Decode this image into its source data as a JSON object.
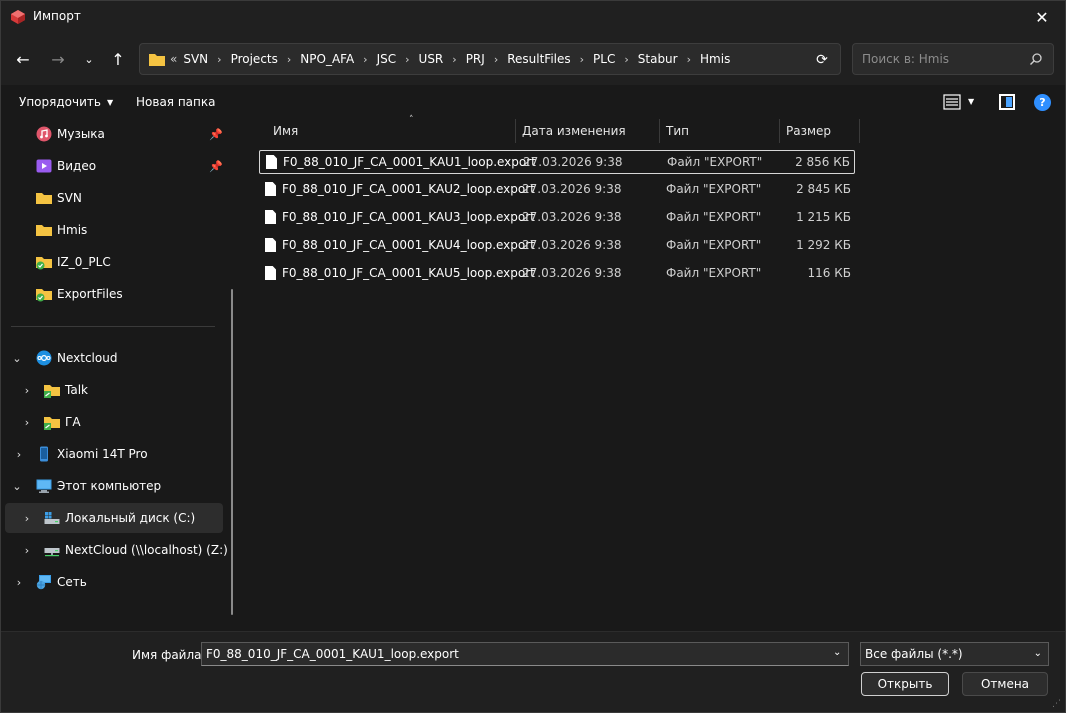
{
  "window": {
    "title": "Импорт"
  },
  "nav": {
    "address_lead": "«",
    "crumbs": [
      "SVN",
      "Projects",
      "NPO_AFA",
      "JSC",
      "USR",
      "PRJ",
      "ResultFiles",
      "PLC",
      "Stabur",
      "Hmis"
    ],
    "search_placeholder": "Поиск в: Hmis"
  },
  "toolbar": {
    "organize_label": "Упорядочить",
    "new_folder_label": "Новая папка"
  },
  "sidebar": {
    "items": [
      {
        "label": "Музыка",
        "icon": "music-icon",
        "pinned": true
      },
      {
        "label": "Видео",
        "icon": "video-icon",
        "pinned": true
      },
      {
        "label": "SVN",
        "icon": "folder-icon"
      },
      {
        "label": "Hmis",
        "icon": "folder-icon"
      },
      {
        "label": "IZ_0_PLC",
        "icon": "svn-folder-icon"
      },
      {
        "label": "ExportFiles",
        "icon": "svn-folder-icon"
      },
      {
        "label": "Nextcloud",
        "icon": "nextcloud-icon"
      },
      {
        "label": "Talk",
        "icon": "shared-folder-icon"
      },
      {
        "label": "ГА",
        "icon": "shared-folder-icon"
      },
      {
        "label": "Xiaomi 14T Pro",
        "icon": "phone-icon"
      },
      {
        "label": "Этот компьютер",
        "icon": "computer-icon"
      },
      {
        "label": "Локальный диск (C:)",
        "icon": "drive-icon"
      },
      {
        "label": "NextCloud (\\\\localhost) (Z:)",
        "icon": "network-drive-icon"
      },
      {
        "label": "Сеть",
        "icon": "network-icon"
      }
    ]
  },
  "columns": {
    "name": "Имя",
    "date": "Дата изменения",
    "type": "Тип",
    "size": "Размер"
  },
  "files": [
    {
      "name": "F0_88_010_JF_CA_0001_KAU1_loop.export",
      "date": "27.03.2026 9:38",
      "type": "Файл \"EXPORT\"",
      "size": "2 856 КБ"
    },
    {
      "name": "F0_88_010_JF_CA_0001_KAU2_loop.export",
      "date": "27.03.2026 9:38",
      "type": "Файл \"EXPORT\"",
      "size": "2 845 КБ"
    },
    {
      "name": "F0_88_010_JF_CA_0001_KAU3_loop.export",
      "date": "27.03.2026 9:38",
      "type": "Файл \"EXPORT\"",
      "size": "1 215 КБ"
    },
    {
      "name": "F0_88_010_JF_CA_0001_KAU4_loop.export",
      "date": "27.03.2026 9:38",
      "type": "Файл \"EXPORT\"",
      "size": "1 292 КБ"
    },
    {
      "name": "F0_88_010_JF_CA_0001_KAU5_loop.export",
      "date": "27.03.2026 9:38",
      "type": "Файл \"EXPORT\"",
      "size": "116 КБ"
    }
  ],
  "bottom": {
    "filename_label": "Имя файла:",
    "filename_value": "F0_88_010_JF_CA_0001_KAU1_loop.export",
    "filter_value": "Все файлы (*.*)",
    "open_label": "Открыть",
    "cancel_label": "Отмена"
  },
  "colors": {
    "background": "#191919",
    "chrome": "#202020",
    "accent": "#2f8fff",
    "folder": "#f4c342"
  }
}
